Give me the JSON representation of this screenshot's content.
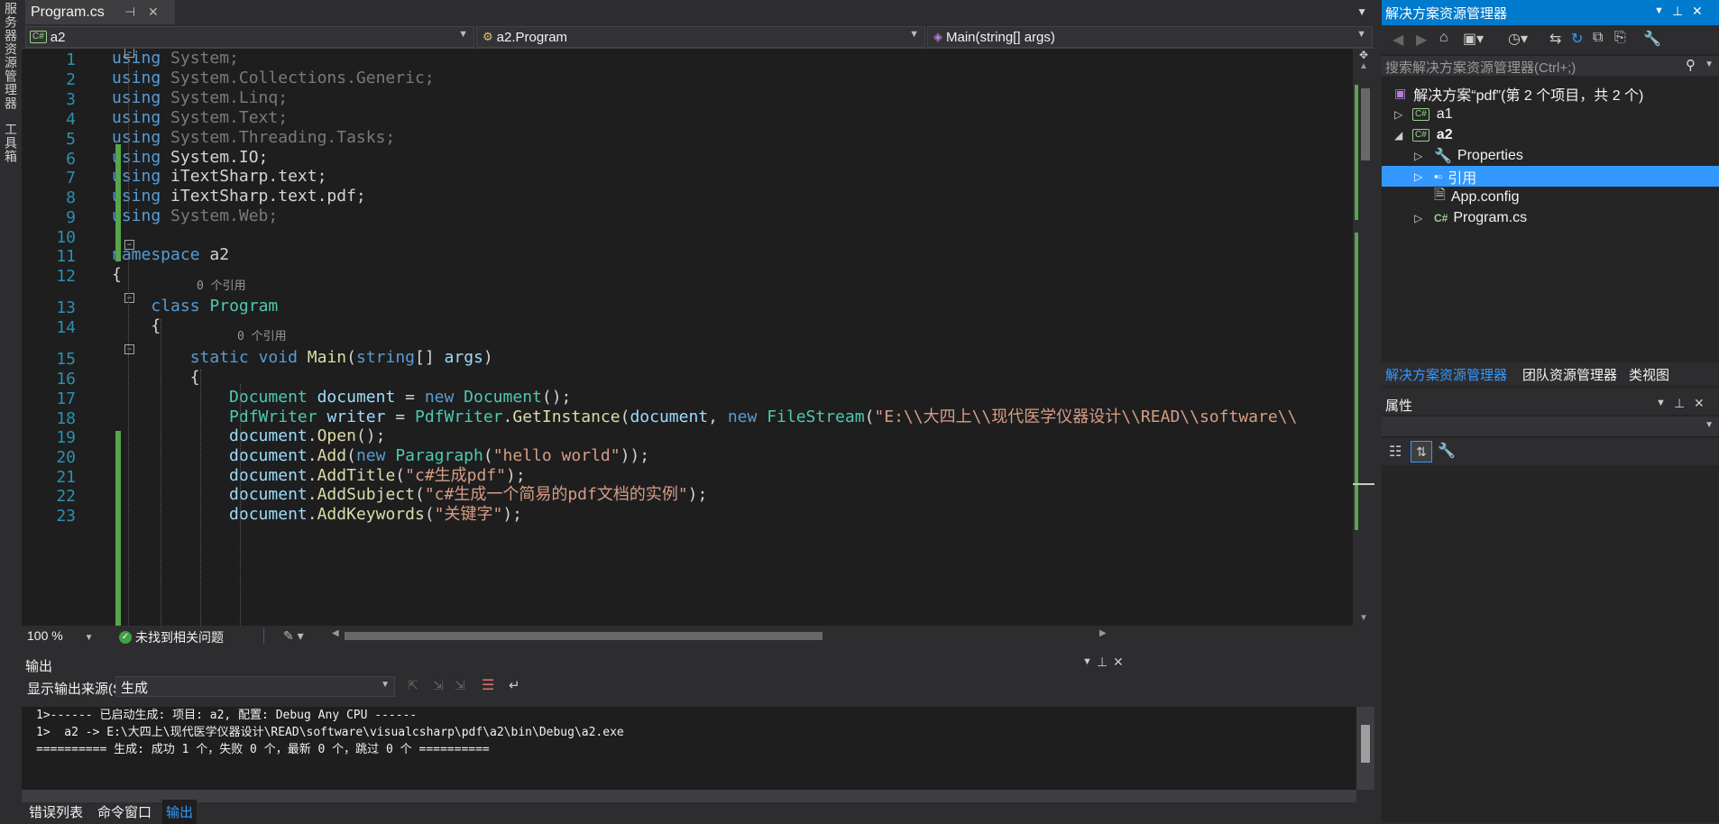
{
  "left_rail": {
    "tabs": [
      "服务器资源管理器",
      "工具箱"
    ]
  },
  "editor": {
    "tab_label": "Program.cs",
    "nav": {
      "project": "a2",
      "class": "a2.Program",
      "member": "Main(string[] args)"
    },
    "hints": {
      "ref0_class": "0 个引用",
      "ref0_method": "0 个引用"
    },
    "lines": [
      {
        "n": "1",
        "segs": [
          [
            "kw",
            "using"
          ],
          [
            "dim",
            " System;"
          ]
        ]
      },
      {
        "n": "2",
        "segs": [
          [
            "kw",
            "using"
          ],
          [
            "dim",
            " System.Collections.Generic;"
          ]
        ]
      },
      {
        "n": "3",
        "segs": [
          [
            "kw",
            "using"
          ],
          [
            "dim",
            " System.Linq;"
          ]
        ]
      },
      {
        "n": "4",
        "segs": [
          [
            "kw",
            "using"
          ],
          [
            "dim",
            " System.Text;"
          ]
        ]
      },
      {
        "n": "5",
        "segs": [
          [
            "kw",
            "using"
          ],
          [
            "dim",
            " System.Threading.Tasks;"
          ]
        ]
      },
      {
        "n": "6",
        "segs": [
          [
            "kw",
            "using"
          ],
          [
            "pl",
            " System.IO;"
          ]
        ]
      },
      {
        "n": "7",
        "segs": [
          [
            "kw",
            "using"
          ],
          [
            "pl",
            " iTextSharp.text;"
          ]
        ]
      },
      {
        "n": "8",
        "segs": [
          [
            "kw",
            "using"
          ],
          [
            "pl",
            " iTextSharp.text.pdf;"
          ]
        ]
      },
      {
        "n": "9",
        "segs": [
          [
            "kw",
            "using"
          ],
          [
            "dim",
            " System.Web;"
          ]
        ]
      },
      {
        "n": "10",
        "segs": []
      },
      {
        "n": "11",
        "segs": [
          [
            "kw",
            "namespace"
          ],
          [
            "pl",
            " a2"
          ]
        ]
      },
      {
        "n": "12",
        "segs": [
          [
            "pl",
            "{"
          ]
        ]
      },
      {
        "n": "13",
        "segs": [
          [
            "pl",
            "    "
          ],
          [
            "kw",
            "class"
          ],
          [
            "pl",
            " "
          ],
          [
            "ty",
            "Program"
          ]
        ]
      },
      {
        "n": "14",
        "segs": [
          [
            "pl",
            "    {"
          ]
        ]
      },
      {
        "n": "15",
        "segs": [
          [
            "pl",
            "        "
          ],
          [
            "kw",
            "static"
          ],
          [
            "pl",
            " "
          ],
          [
            "kw",
            "void"
          ],
          [
            "pl",
            " "
          ],
          [
            "fn",
            "Main"
          ],
          [
            "pl",
            "("
          ],
          [
            "kw",
            "string"
          ],
          [
            "pl",
            "[] "
          ],
          [
            "id",
            "args"
          ],
          [
            "pl",
            ")"
          ]
        ]
      },
      {
        "n": "16",
        "segs": [
          [
            "pl",
            "        {"
          ]
        ]
      },
      {
        "n": "17",
        "segs": [
          [
            "pl",
            "            "
          ],
          [
            "ty",
            "Document"
          ],
          [
            "pl",
            " "
          ],
          [
            "id",
            "document"
          ],
          [
            "pl",
            " = "
          ],
          [
            "kw",
            "new"
          ],
          [
            "pl",
            " "
          ],
          [
            "ty",
            "Document"
          ],
          [
            "pl",
            "();"
          ]
        ]
      },
      {
        "n": "18",
        "segs": [
          [
            "pl",
            "            "
          ],
          [
            "ty",
            "PdfWriter"
          ],
          [
            "pl",
            " "
          ],
          [
            "id",
            "writer"
          ],
          [
            "pl",
            " = "
          ],
          [
            "ty",
            "PdfWriter"
          ],
          [
            "pl",
            "."
          ],
          [
            "fn",
            "GetInstance"
          ],
          [
            "pl",
            "("
          ],
          [
            "id",
            "document"
          ],
          [
            "pl",
            ", "
          ],
          [
            "kw",
            "new"
          ],
          [
            "pl",
            " "
          ],
          [
            "ty",
            "FileStream"
          ],
          [
            "pl",
            "("
          ],
          [
            "st",
            "\"E:\\\\大四上\\\\现代医学仪器设计\\\\READ\\\\software\\\\"
          ]
        ]
      },
      {
        "n": "19",
        "segs": [
          [
            "pl",
            "            "
          ],
          [
            "id",
            "document"
          ],
          [
            "pl",
            "."
          ],
          [
            "fn",
            "Open"
          ],
          [
            "pl",
            "();"
          ]
        ]
      },
      {
        "n": "20",
        "segs": [
          [
            "pl",
            "            "
          ],
          [
            "id",
            "document"
          ],
          [
            "pl",
            "."
          ],
          [
            "fn",
            "Add"
          ],
          [
            "pl",
            "("
          ],
          [
            "kw",
            "new"
          ],
          [
            "pl",
            " "
          ],
          [
            "ty",
            "Paragraph"
          ],
          [
            "pl",
            "("
          ],
          [
            "st",
            "\"hello world\""
          ],
          [
            "pl",
            "));"
          ]
        ]
      },
      {
        "n": "21",
        "segs": [
          [
            "pl",
            "            "
          ],
          [
            "id",
            "document"
          ],
          [
            "pl",
            "."
          ],
          [
            "fn",
            "AddTitle"
          ],
          [
            "pl",
            "("
          ],
          [
            "st",
            "\"c#生成pdf\""
          ],
          [
            "pl",
            ");"
          ]
        ]
      },
      {
        "n": "22",
        "segs": [
          [
            "pl",
            "            "
          ],
          [
            "id",
            "document"
          ],
          [
            "pl",
            "."
          ],
          [
            "fn",
            "AddSubject"
          ],
          [
            "pl",
            "("
          ],
          [
            "st",
            "\"c#生成一个简易的pdf文档的实例\""
          ],
          [
            "pl",
            ");"
          ]
        ]
      },
      {
        "n": "23",
        "segs": [
          [
            "pl",
            "            "
          ],
          [
            "id",
            "document"
          ],
          [
            "pl",
            "."
          ],
          [
            "fn",
            "AddKeywords"
          ],
          [
            "pl",
            "("
          ],
          [
            "st",
            "\"关键字\""
          ],
          [
            "pl",
            ");"
          ]
        ]
      }
    ],
    "zoom": "100 %",
    "issues": "未找到相关问题"
  },
  "output": {
    "title": "输出",
    "source_label": "显示输出来源(S):",
    "source_value": "生成",
    "lines": [
      "1>------ 已启动生成: 项目: a2, 配置: Debug Any CPU ------",
      "1>  a2 -> E:\\大四上\\现代医学仪器设计\\READ\\software\\visualcsharp\\pdf\\a2\\bin\\Debug\\a2.exe",
      "========== 生成: 成功 1 个，失败 0 个，最新 0 个，跳过 0 个 =========="
    ],
    "bottom_tabs": [
      "错误列表",
      "命令窗口",
      "输出"
    ]
  },
  "solution": {
    "title": "解决方案资源管理器",
    "search_placeholder": "搜索解决方案资源管理器(Ctrl+;)",
    "root": "解决方案“pdf”(第 2 个项目，共 2 个)",
    "items": {
      "a1": "a1",
      "a2": "a2",
      "properties": "Properties",
      "references": "引用",
      "appconfig": "App.config",
      "programcs": "Program.cs"
    },
    "cs_badge": "C#",
    "tabs": [
      "解决方案资源管理器",
      "团队资源管理器",
      "类视图"
    ]
  },
  "properties": {
    "title": "属性"
  },
  "colors": {
    "accent": "#007acc",
    "selection": "#3399ff",
    "editor_bg": "#1e1e1e",
    "line_number": "#2b91af",
    "change_bar": "#57a64a"
  }
}
